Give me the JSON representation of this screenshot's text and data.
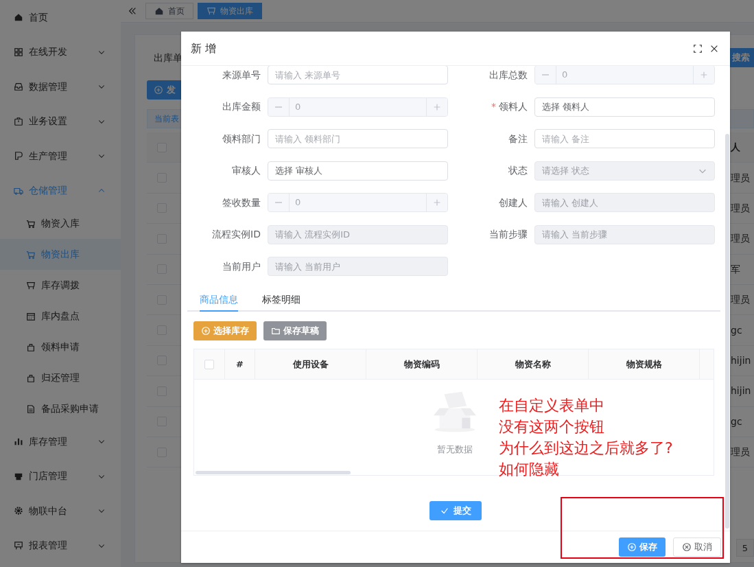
{
  "sidebar": {
    "items": [
      {
        "label": "首页",
        "kind": "link"
      },
      {
        "label": "在线开发",
        "kind": "group",
        "expanded": false
      },
      {
        "label": "数据管理",
        "kind": "group",
        "expanded": false
      },
      {
        "label": "业务设置",
        "kind": "group",
        "expanded": false
      },
      {
        "label": "生产管理",
        "kind": "group",
        "expanded": false
      },
      {
        "label": "仓储管理",
        "kind": "group",
        "expanded": true,
        "children": [
          {
            "label": "物资入库",
            "selected": false
          },
          {
            "label": "物资出库",
            "selected": true
          },
          {
            "label": "库存调拨",
            "selected": false
          },
          {
            "label": "库内盘点",
            "selected": false
          },
          {
            "label": "领料申请",
            "selected": false
          },
          {
            "label": "归还管理",
            "selected": false
          },
          {
            "label": "备品采购申请",
            "selected": false
          }
        ]
      },
      {
        "label": "库存管理",
        "kind": "group",
        "expanded": false
      },
      {
        "label": "门店管理",
        "kind": "group",
        "expanded": false
      },
      {
        "label": "物联中台",
        "kind": "group",
        "expanded": false
      },
      {
        "label": "报表管理",
        "kind": "group",
        "expanded": false
      }
    ]
  },
  "tab_bar": {
    "tabs": [
      {
        "label": "首页",
        "selected": false
      },
      {
        "label": "物资出库",
        "selected": true
      }
    ]
  },
  "page": {
    "filter_label": "出库单",
    "search_button": "搜索",
    "add_button": "发",
    "info_text": "当前表",
    "table": {
      "select_all_checked": false,
      "header_last": "人",
      "rows": [
        {
          "checked": false,
          "column_last": "理员"
        },
        {
          "checked": false,
          "column_last": "理员"
        },
        {
          "checked": false,
          "column_last": "理员"
        },
        {
          "checked": false,
          "column_last": "军"
        },
        {
          "checked": false,
          "column_last": "理员"
        },
        {
          "checked": false,
          "column_last": "gc"
        },
        {
          "checked": false,
          "column_last": "hijin"
        },
        {
          "checked": false,
          "column_last": "hijin"
        },
        {
          "checked": false,
          "column_last": "gc"
        },
        {
          "checked": false,
          "column_last": "理员"
        }
      ]
    },
    "pagination": "5"
  },
  "dialog": {
    "title": "新 增",
    "fields": [
      {
        "label": "来源单号",
        "kind": "text",
        "placeholder": "请输入 来源单号",
        "disabled": false
      },
      {
        "label": "出库总数",
        "kind": "number",
        "value": "0",
        "disabled": true
      },
      {
        "label": "出库金额",
        "kind": "number",
        "value": "0",
        "disabled": true
      },
      {
        "label": "领料人",
        "kind": "picker",
        "placeholder": "选择 领料人",
        "disabled": false,
        "required_mark": "*"
      },
      {
        "label": "领料部门",
        "kind": "text",
        "placeholder": "请输入 领料部门",
        "disabled": false
      },
      {
        "label": "备注",
        "kind": "text",
        "placeholder": "请输入 备注",
        "disabled": false
      },
      {
        "label": "审核人",
        "kind": "picker",
        "placeholder": "选择 审核人",
        "disabled": false
      },
      {
        "label": "状态",
        "kind": "select",
        "placeholder": "请选择 状态",
        "disabled": true
      },
      {
        "label": "签收数量",
        "kind": "number",
        "value": "0",
        "disabled": true
      },
      {
        "label": "创建人",
        "kind": "text",
        "placeholder": "请输入 创建人",
        "disabled": true
      },
      {
        "label": "流程实例ID",
        "kind": "text",
        "placeholder": "请输入 流程实例ID",
        "disabled": true
      },
      {
        "label": "当前步骤",
        "kind": "text",
        "placeholder": "请输入 当前步骤",
        "disabled": true
      },
      {
        "label": "当前用户",
        "kind": "text",
        "placeholder": "请输入 当前用户",
        "disabled": true
      }
    ],
    "tabs": [
      {
        "label": "商品信息",
        "selected": true
      },
      {
        "label": "标签明细",
        "selected": false
      }
    ],
    "toolbar": [
      {
        "label": "选择库存",
        "kind": "add"
      },
      {
        "label": "保存草稿",
        "kind": "draft"
      }
    ],
    "table": {
      "select_all_checked": false,
      "columns": [
        "#",
        "使用设备",
        "物资编码",
        "物资名称",
        "物资规格"
      ],
      "empty_text": "暂无数据"
    },
    "submit_button": "提交",
    "footer_buttons": [
      {
        "label": "保存",
        "kind": "primary"
      },
      {
        "label": "取消",
        "kind": "default"
      }
    ]
  },
  "annotation": {
    "lines": [
      "在自定义表单中",
      "没有这两个按钮",
      "为什么到这边之后就多了?",
      "如何隐藏"
    ]
  }
}
